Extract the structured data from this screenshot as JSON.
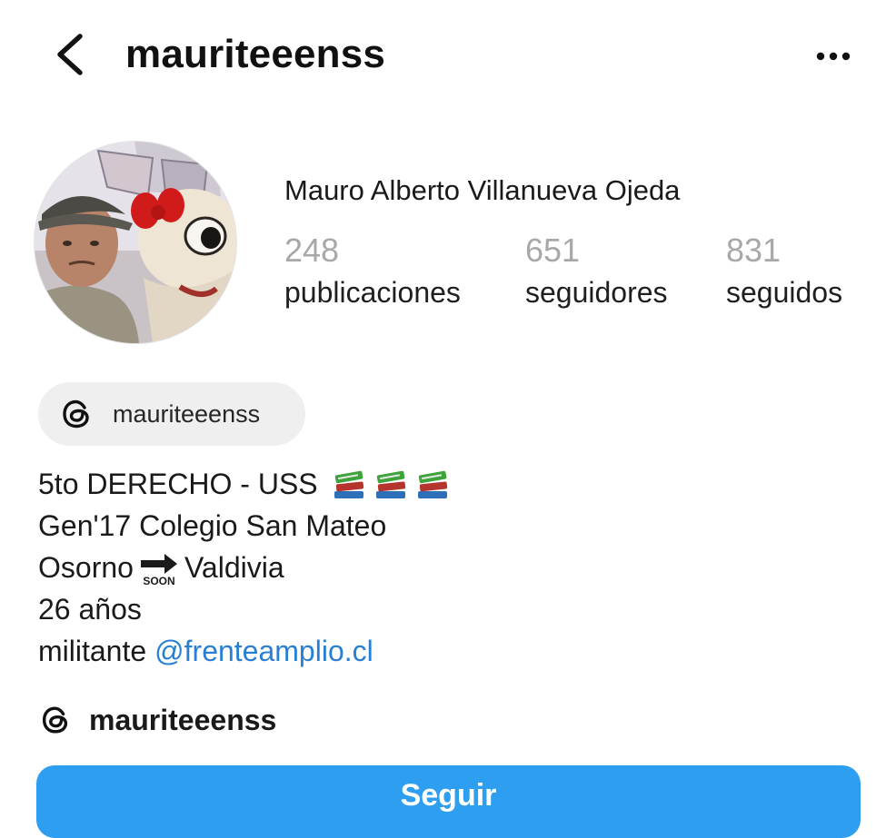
{
  "header": {
    "username": "mauriteeenss",
    "back_icon": "chevron-left-icon",
    "more_icon": "more-horizontal-icon"
  },
  "profile": {
    "full_name": "Mauro Alberto Villanueva Ojeda",
    "avatar_icon": "profile-photo",
    "stats": {
      "posts": {
        "count": "248",
        "label": "publicaciones"
      },
      "followers": {
        "count": "651",
        "label": "seguidores"
      },
      "following": {
        "count": "831",
        "label": "seguidos"
      }
    }
  },
  "threads_badge": {
    "icon": "threads-icon",
    "label": "mauriteeenss"
  },
  "bio": {
    "line1_text": "5to DERECHO - USS",
    "line1_emoji": "books-icon",
    "line1_emoji_count": 3,
    "line2": "Gen'17 Colegio San Mateo",
    "line3_from": "Osorno",
    "line3_glyph": "soon-arrow-icon",
    "line3_glyph_text": "SOON",
    "line3_to": "Valdivia",
    "line4": "26 años",
    "line5_prefix": "militante",
    "line5_mention": "@frenteamplio.cl"
  },
  "threads_link": {
    "icon": "threads-icon",
    "label": "mauriteeenss"
  },
  "follow_button": {
    "label": "Seguir"
  },
  "colors": {
    "accent": "#2d9ef0",
    "link": "#2a7fd4",
    "muted_number": "#a8a8a8",
    "chip_background": "#efefef"
  }
}
